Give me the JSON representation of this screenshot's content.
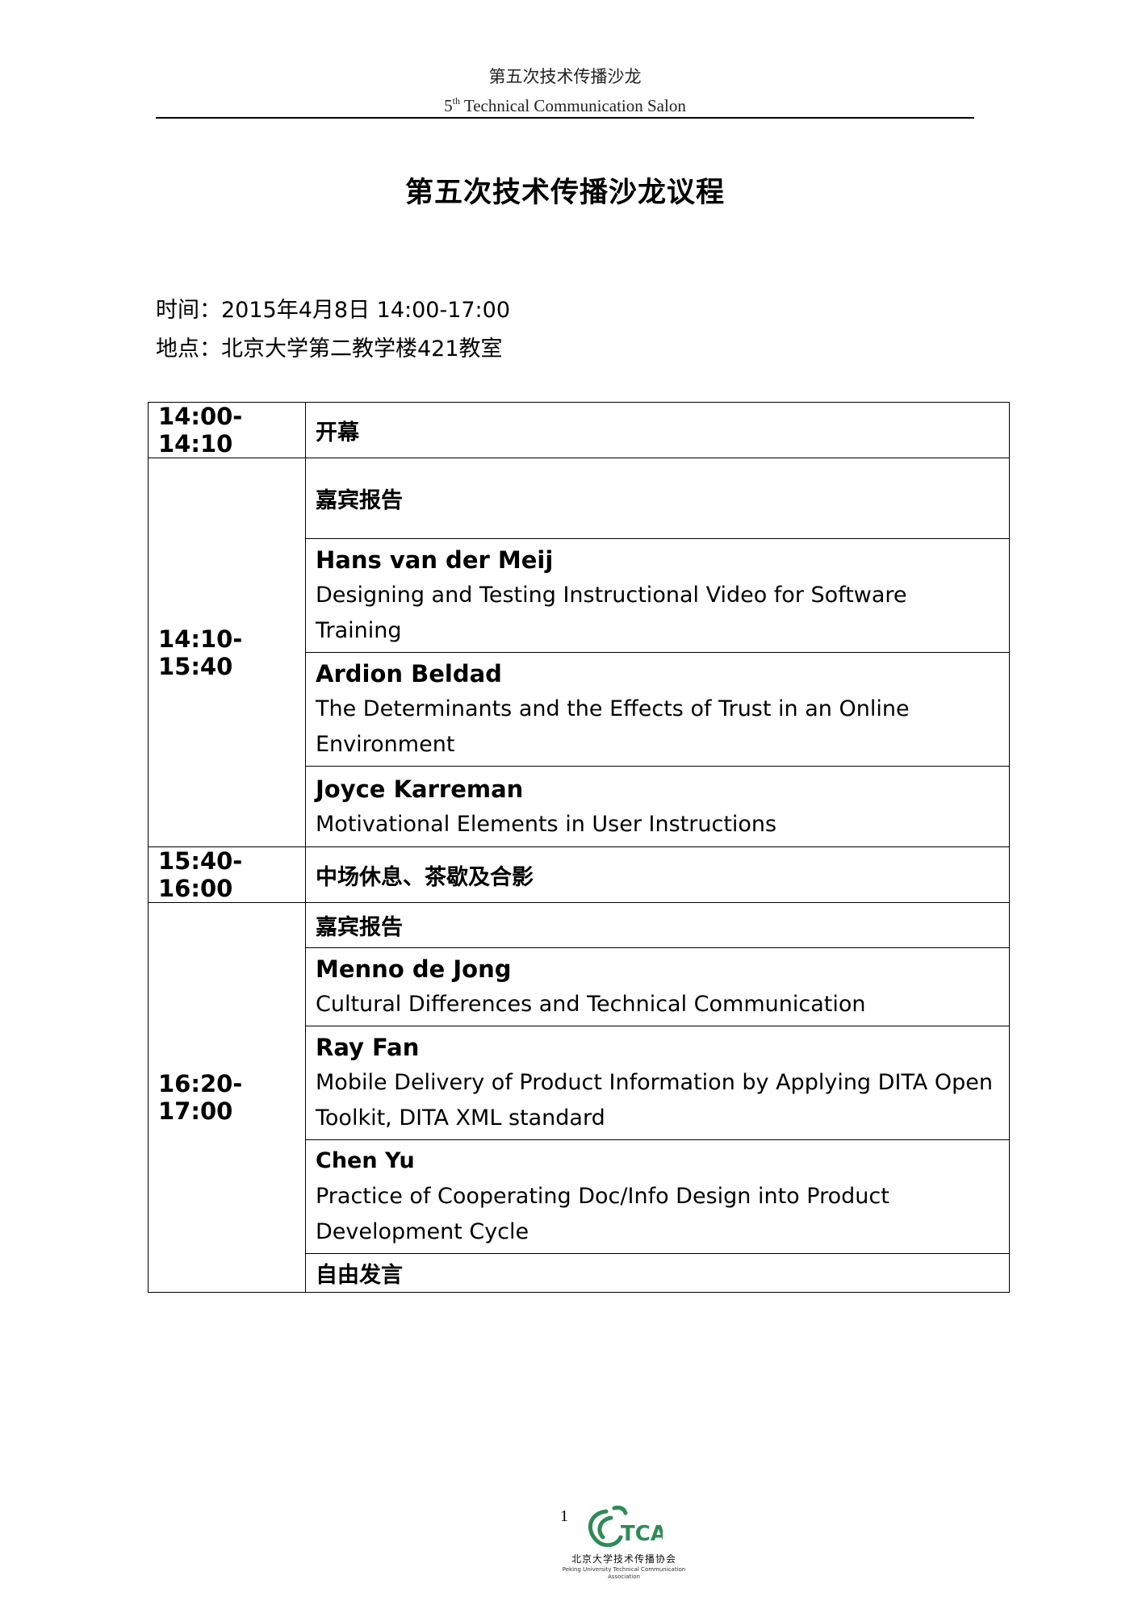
{
  "header": {
    "cn": "第五次技术传播沙龙",
    "en_num": "5",
    "en_sup": "th",
    "en_rest": " Technical Communication Salon"
  },
  "title": "第五次技术传播沙龙议程",
  "meta": {
    "time_line": "时间：2015年4月8日  14:00-17:00",
    "place_line": "地点：北京大学第二教学楼421教室"
  },
  "agenda": {
    "opening": {
      "time": "14:00-14:10",
      "label": "开幕"
    },
    "session1": {
      "time": "14:10-15:40",
      "heading": "嘉宾报告",
      "talks": [
        {
          "speaker": "Hans van der Meij",
          "title": "Designing and Testing Instructional Video for Software Training"
        },
        {
          "speaker": "Ardion Beldad",
          "title": "The Determinants and the Effects of Trust in an Online Environment"
        },
        {
          "speaker": "Joyce Karreman",
          "title": "Motivational Elements in User Instructions"
        }
      ]
    },
    "break": {
      "time": "15:40-16:00",
      "label": "中场休息、茶歇及合影"
    },
    "session2": {
      "time": "16:20-17:00",
      "heading": "嘉宾报告",
      "talks": [
        {
          "speaker": "Menno de Jong",
          "title": "Cultural Differences and Technical Communication"
        },
        {
          "speaker": "Ray Fan",
          "title": "Mobile Delivery of Product Information by Applying DITA Open Toolkit, DITA XML standard"
        },
        {
          "speaker": "Chen Yu",
          "title": "Practice of Cooperating Doc/Info Design into Product Development Cycle"
        }
      ],
      "closing": "自由发言"
    }
  },
  "footer": {
    "page_number": "1",
    "logo_letters": "TCA",
    "logo_cn": "北京大学技术传播协会",
    "logo_en": "Peking University Technical Communication Association",
    "logo_color": "#2e8b57"
  }
}
